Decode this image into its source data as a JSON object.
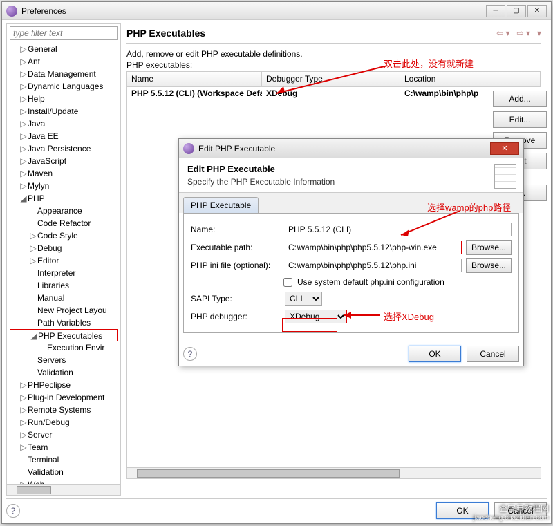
{
  "main_window": {
    "title": "Preferences",
    "filter_placeholder": "type filter text",
    "tree": [
      {
        "label": "General",
        "level": 1,
        "arrow": "▷"
      },
      {
        "label": "Ant",
        "level": 1,
        "arrow": "▷"
      },
      {
        "label": "Data Management",
        "level": 1,
        "arrow": "▷"
      },
      {
        "label": "Dynamic Languages",
        "level": 1,
        "arrow": "▷"
      },
      {
        "label": "Help",
        "level": 1,
        "arrow": "▷"
      },
      {
        "label": "Install/Update",
        "level": 1,
        "arrow": "▷"
      },
      {
        "label": "Java",
        "level": 1,
        "arrow": "▷"
      },
      {
        "label": "Java EE",
        "level": 1,
        "arrow": "▷"
      },
      {
        "label": "Java Persistence",
        "level": 1,
        "arrow": "▷"
      },
      {
        "label": "JavaScript",
        "level": 1,
        "arrow": "▷"
      },
      {
        "label": "Maven",
        "level": 1,
        "arrow": "▷"
      },
      {
        "label": "Mylyn",
        "level": 1,
        "arrow": "▷"
      },
      {
        "label": "PHP",
        "level": 1,
        "arrow": "◢"
      },
      {
        "label": "Appearance",
        "level": 2,
        "arrow": ""
      },
      {
        "label": "Code Refactor",
        "level": 2,
        "arrow": ""
      },
      {
        "label": "Code Style",
        "level": 2,
        "arrow": "▷"
      },
      {
        "label": "Debug",
        "level": 2,
        "arrow": "▷"
      },
      {
        "label": "Editor",
        "level": 2,
        "arrow": "▷"
      },
      {
        "label": "Interpreter",
        "level": 2,
        "arrow": ""
      },
      {
        "label": "Libraries",
        "level": 2,
        "arrow": ""
      },
      {
        "label": "Manual",
        "level": 2,
        "arrow": ""
      },
      {
        "label": "New Project Layou",
        "level": 2,
        "arrow": ""
      },
      {
        "label": "Path Variables",
        "level": 2,
        "arrow": ""
      },
      {
        "label": "PHP Executables",
        "level": 2,
        "arrow": "◢",
        "selected": true
      },
      {
        "label": "Execution Envir",
        "level": 3,
        "arrow": ""
      },
      {
        "label": "Servers",
        "level": 2,
        "arrow": ""
      },
      {
        "label": "Validation",
        "level": 2,
        "arrow": ""
      },
      {
        "label": "PHPeclipse",
        "level": 1,
        "arrow": "▷"
      },
      {
        "label": "Plug-in Development",
        "level": 1,
        "arrow": "▷"
      },
      {
        "label": "Remote Systems",
        "level": 1,
        "arrow": "▷"
      },
      {
        "label": "Run/Debug",
        "level": 1,
        "arrow": "▷"
      },
      {
        "label": "Server",
        "level": 1,
        "arrow": "▷"
      },
      {
        "label": "Team",
        "level": 1,
        "arrow": "▷"
      },
      {
        "label": "Terminal",
        "level": 1,
        "arrow": ""
      },
      {
        "label": "Validation",
        "level": 1,
        "arrow": ""
      },
      {
        "label": "Web",
        "level": 1,
        "arrow": "▷"
      }
    ],
    "panel": {
      "title": "PHP Executables",
      "description": "Add, remove or edit PHP executable definitions.",
      "list_label": "PHP executables:",
      "columns": {
        "name": "Name",
        "debugger": "Debugger Type",
        "location": "Location"
      },
      "row": {
        "name": "PHP 5.5.12 (CLI)  (Workspace Defa...",
        "debugger": "XDebug",
        "location": "C:\\wamp\\bin\\php\\p"
      },
      "buttons": {
        "add": "Add...",
        "edit": "Edit...",
        "remove": "Remove",
        "default": "ault",
        "search": "h..."
      }
    },
    "bottom": {
      "ok": "OK",
      "cancel": "Cancel"
    }
  },
  "dialog": {
    "title": "Edit PHP Executable",
    "header_title": "Edit PHP Executable",
    "header_sub": "Specify the PHP Executable Information",
    "tab": "PHP Executable",
    "fields": {
      "name_label": "Name:",
      "name_value": "PHP 5.5.12 (CLI)",
      "exec_label": "Executable path:",
      "exec_value": "C:\\wamp\\bin\\php\\php5.5.12\\php-win.exe",
      "ini_label": "PHP ini file (optional):",
      "ini_value": "C:\\wamp\\bin\\php\\php5.5.12\\php.ini",
      "checkbox_label": "Use system default php.ini configuration",
      "sapi_label": "SAPI Type:",
      "sapi_value": "CLI",
      "debugger_label": "PHP debugger:",
      "debugger_value": "XDebug",
      "browse": "Browse..."
    },
    "bottom": {
      "ok": "OK",
      "cancel": "Cancel"
    }
  },
  "annotations": {
    "a1": "双击此处，没有就新建",
    "a2": "选择wamp的php路径",
    "a3": "选择XDebug"
  },
  "watermark": {
    "l1": "查字典教程网",
    "l2": "jiaocheng.chazidian.com"
  }
}
